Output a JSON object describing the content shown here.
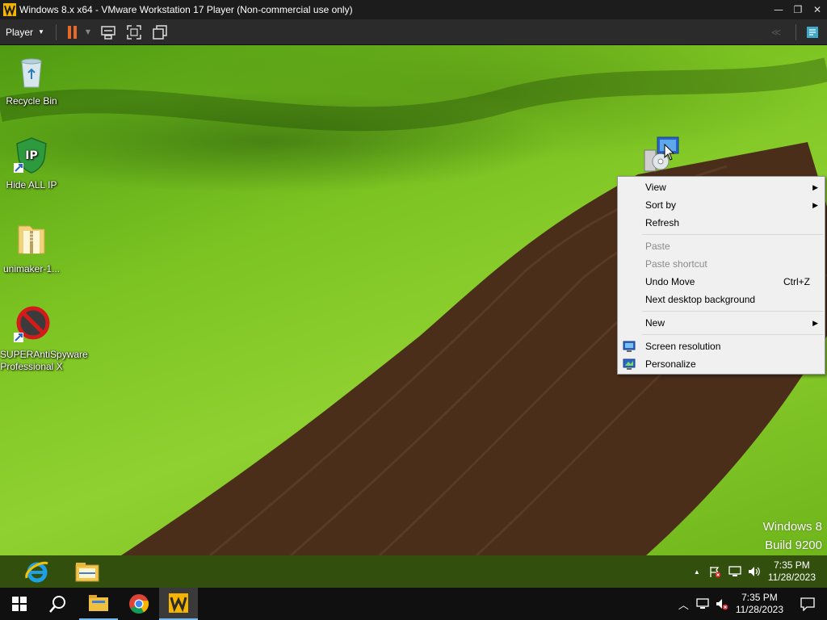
{
  "window": {
    "title": "Windows 8.x x64 - VMware Workstation 17 Player (Non-commercial use only)",
    "controls": {
      "minimize": "—",
      "maximize": "❐",
      "close": "✕"
    }
  },
  "toolbar": {
    "player_menu": "Player",
    "icons": [
      "pause-icon",
      "dropdown-icon",
      "send-ctrl-alt-del-icon",
      "full-screen-icon",
      "unity-icon",
      "back-icon",
      "message-icon"
    ]
  },
  "desktop": {
    "icons": [
      {
        "label": "Recycle Bin",
        "icon": "recycle-bin-icon"
      },
      {
        "label": "Hide ALL IP",
        "icon": "hide-all-ip-icon"
      },
      {
        "label": "unimaker-1...",
        "icon": "folder-zip-icon"
      },
      {
        "label": "SUPERAntiSpyware Professional X",
        "icon": "superantispyware-icon"
      }
    ],
    "watermark": {
      "line1": "Windows 8",
      "line2": "Build 9200"
    }
  },
  "context_menu": {
    "items": [
      {
        "label": "View",
        "has_submenu": true
      },
      {
        "label": "Sort by",
        "has_submenu": true
      },
      {
        "label": "Refresh"
      },
      {
        "label": "Paste",
        "disabled": true
      },
      {
        "label": "Paste shortcut",
        "disabled": true
      },
      {
        "label": "Undo Move",
        "shortcut": "Ctrl+Z"
      },
      {
        "label": "Next desktop background"
      },
      {
        "label": "New",
        "has_submenu": true
      },
      {
        "label": "Screen resolution",
        "icon": "screen-resolution-icon"
      },
      {
        "label": "Personalize",
        "icon": "personalize-icon"
      }
    ],
    "submenu_arrow": "▶"
  },
  "guest_taskbar": {
    "apps": [
      "internet-explorer-icon",
      "file-explorer-icon"
    ],
    "tray": {
      "show_hidden": "▲",
      "time": "7:35 PM",
      "date": "11/28/2023"
    }
  },
  "host_taskbar": {
    "apps": [
      "start-icon",
      "search-icon",
      "file-explorer-icon",
      "chrome-icon",
      "vmware-player-icon"
    ],
    "tray": {
      "show_hidden": "︿",
      "time": "7:35 PM",
      "date": "11/28/2023"
    }
  },
  "colors": {
    "accent": "#76b9ed",
    "menu_bg": "#f0f0f0",
    "titlebar": "#1c1c1c",
    "toolbar": "#2b2b2b"
  }
}
